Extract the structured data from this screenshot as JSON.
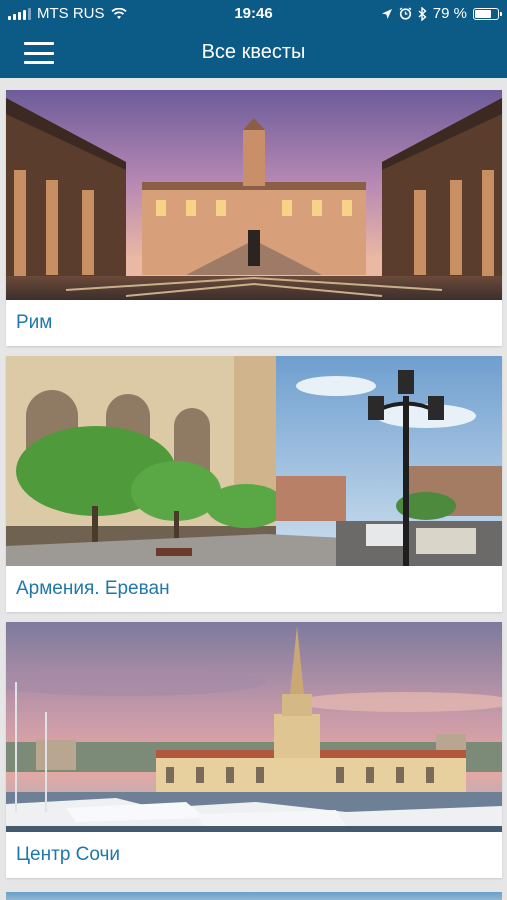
{
  "status_bar": {
    "carrier": "MTS RUS",
    "time": "19:46",
    "battery_percent": "79 %",
    "battery_level": 0.79,
    "icons": [
      "signal-icon",
      "wifi-icon",
      "location-icon",
      "alarm-icon",
      "bluetooth-icon",
      "battery-icon"
    ]
  },
  "header": {
    "title": "Все квесты",
    "menu_icon": "hamburger-menu-icon",
    "background_color": "#0c5a86"
  },
  "quests": [
    {
      "title": "Рим",
      "image": "rome-capitol-square-photo"
    },
    {
      "title": "Армения. Ереван",
      "image": "yerevan-street-photo"
    },
    {
      "title": "Центр Сочи",
      "image": "sochi-seaport-photo"
    }
  ],
  "colors": {
    "title_text": "#1f77aa",
    "page_background": "#e6e6e6"
  }
}
